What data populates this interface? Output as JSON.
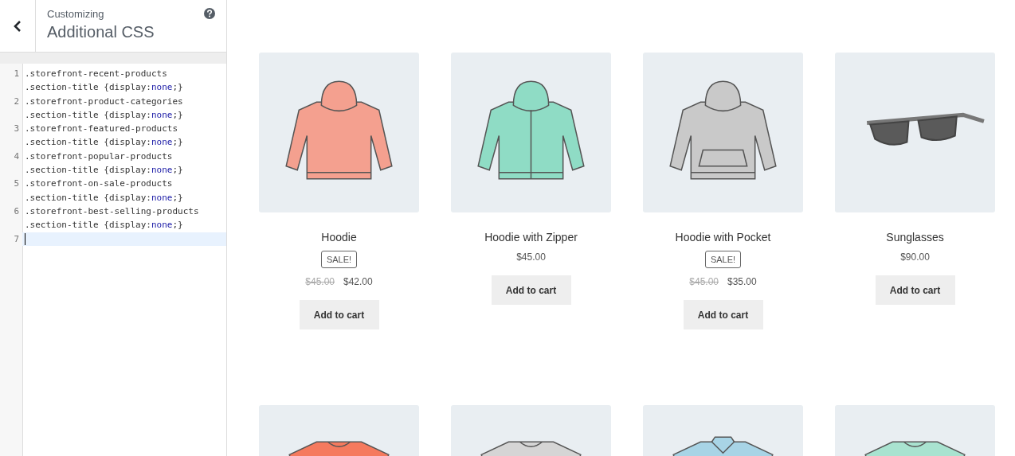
{
  "header": {
    "subtitle": "Customizing",
    "title": "Additional CSS"
  },
  "code_lines": [
    {
      "number": "1",
      "selected": false,
      "rows": [
        [
          {
            "text": ".storefront-recent-products",
            "kind": "plain"
          }
        ],
        [
          {
            "text": ".section-title {display:",
            "kind": "plain"
          },
          {
            "text": "none",
            "kind": "keyword"
          },
          {
            "text": ";}",
            "kind": "plain"
          }
        ]
      ]
    },
    {
      "number": "2",
      "selected": false,
      "rows": [
        [
          {
            "text": ".storefront-product-categories",
            "kind": "plain"
          }
        ],
        [
          {
            "text": ".section-title {display:",
            "kind": "plain"
          },
          {
            "text": "none",
            "kind": "keyword"
          },
          {
            "text": ";}",
            "kind": "plain"
          }
        ]
      ]
    },
    {
      "number": "3",
      "selected": false,
      "rows": [
        [
          {
            "text": ".storefront-featured-products",
            "kind": "plain"
          }
        ],
        [
          {
            "text": ".section-title {display:",
            "kind": "plain"
          },
          {
            "text": "none",
            "kind": "keyword"
          },
          {
            "text": ";}",
            "kind": "plain"
          }
        ]
      ]
    },
    {
      "number": "4",
      "selected": false,
      "rows": [
        [
          {
            "text": ".storefront-popular-products",
            "kind": "plain"
          }
        ],
        [
          {
            "text": ".section-title {display:",
            "kind": "plain"
          },
          {
            "text": "none",
            "kind": "keyword"
          },
          {
            "text": ";}",
            "kind": "plain"
          }
        ]
      ]
    },
    {
      "number": "5",
      "selected": false,
      "rows": [
        [
          {
            "text": ".storefront-on-sale-products",
            "kind": "plain"
          }
        ],
        [
          {
            "text": ".section-title {display:",
            "kind": "plain"
          },
          {
            "text": "none",
            "kind": "keyword"
          },
          {
            "text": ";}",
            "kind": "plain"
          }
        ]
      ]
    },
    {
      "number": "6",
      "selected": false,
      "rows": [
        [
          {
            "text": ".storefront-best-selling-products",
            "kind": "plain"
          }
        ],
        [
          {
            "text": ".section-title {display:",
            "kind": "plain"
          },
          {
            "text": "none",
            "kind": "keyword"
          },
          {
            "text": ";}",
            "kind": "plain"
          }
        ]
      ]
    },
    {
      "number": "7",
      "selected": true
    }
  ],
  "products": [
    {
      "kind": "hoodie",
      "color": "#f4a08f",
      "name": "Hoodie",
      "badge": "SALE!",
      "old_price": "$45.00",
      "price": "$42.00",
      "button": "Add to cart"
    },
    {
      "kind": "zip-hoodie",
      "color": "#8fdcc5",
      "name": "Hoodie with Zipper",
      "price": "$45.00",
      "button": "Add to cart"
    },
    {
      "kind": "pocket-hoodie",
      "color": "#c9c9c9",
      "name": "Hoodie with Pocket",
      "badge": "SALE!",
      "old_price": "$45.00",
      "price": "$35.00",
      "button": "Add to cart"
    },
    {
      "kind": "sunglasses",
      "color": "#5a5a5a",
      "name": "Sunglasses",
      "price": "$90.00",
      "button": "Add to cart"
    },
    {
      "kind": "tshirt",
      "color": "#f57a5e"
    },
    {
      "kind": "tshirt",
      "color": "#d5d5d5"
    },
    {
      "kind": "polo",
      "color": "#a8d4e6"
    },
    {
      "kind": "sweater",
      "color": "#a9e3d0"
    }
  ]
}
